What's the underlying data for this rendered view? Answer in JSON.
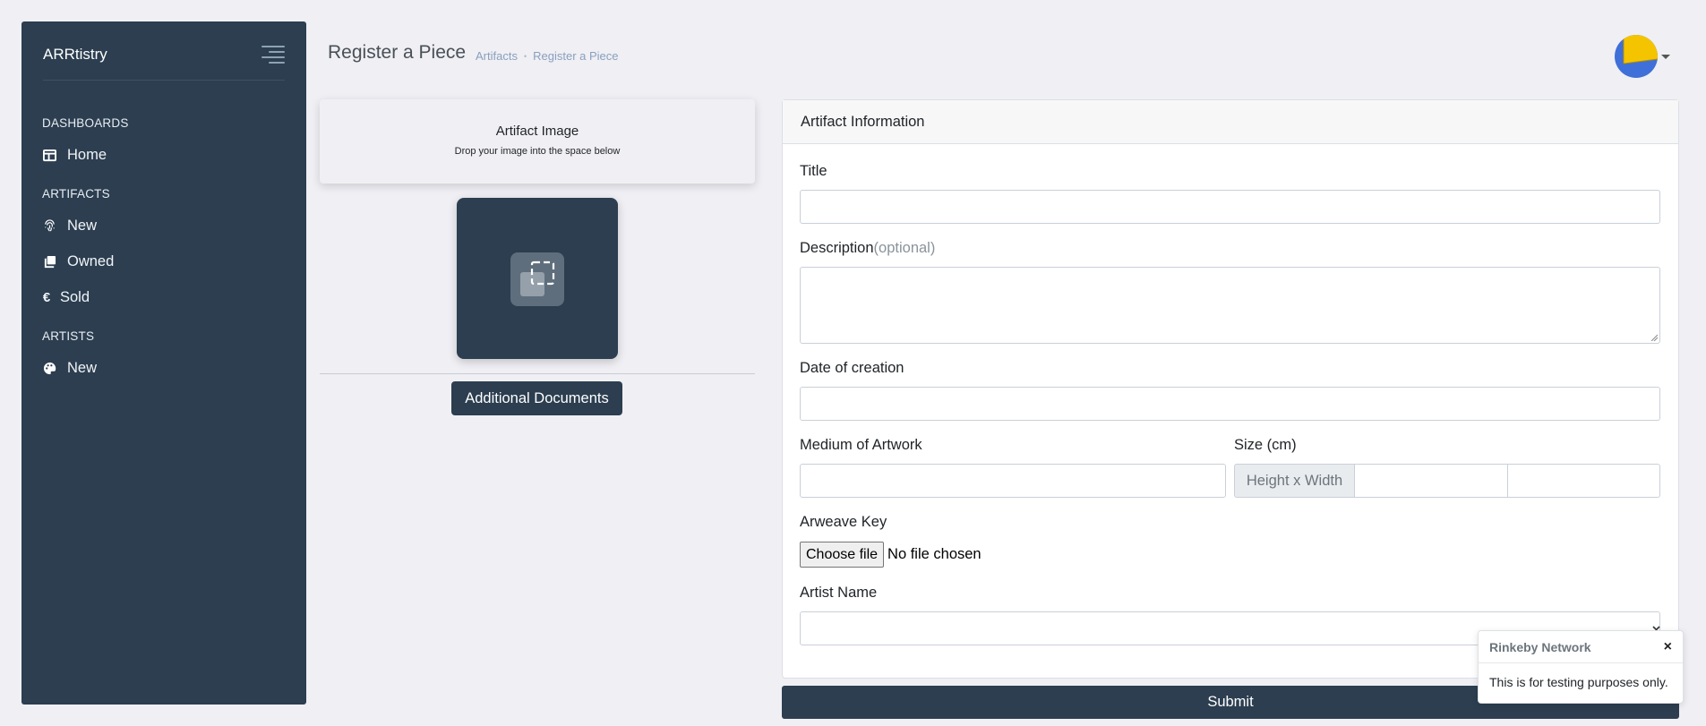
{
  "sidebar": {
    "brand": "ARRtistry",
    "sections": [
      {
        "heading": "DASHBOARDS",
        "items": [
          {
            "label": "Home",
            "icon": "home-layout-icon"
          }
        ]
      },
      {
        "heading": "ARTIFACTS",
        "items": [
          {
            "label": "New",
            "icon": "fingerprint-icon"
          },
          {
            "label": "Owned",
            "icon": "copy-icon"
          },
          {
            "label": "Sold",
            "icon": "euro-icon"
          }
        ]
      },
      {
        "heading": "ARTISTS",
        "items": [
          {
            "label": "New",
            "icon": "palette-icon"
          }
        ]
      }
    ]
  },
  "header": {
    "title": "Register a Piece",
    "breadcrumb": [
      "Artifacts",
      "Register a Piece"
    ],
    "breadcrumb_separator": "•"
  },
  "image_panel": {
    "title": "Artifact Image",
    "subtitle": "Drop your image into the space below",
    "dropzone_icon": "image-upload-icon",
    "docs_button": "Additional Documents"
  },
  "form": {
    "card_title": "Artifact Information",
    "title_label": "Title",
    "title_value": "",
    "description_label": "Description",
    "description_optional": "(optional)",
    "description_value": "",
    "date_label": "Date of creation",
    "date_value": "",
    "medium_label": "Medium of Artwork",
    "medium_value": "",
    "size_label": "Size (cm)",
    "size_addon": "Height x Width",
    "height_value": "",
    "width_value": "",
    "arweave_label": "Arweave Key",
    "file_button": "Choose file",
    "file_status": "No file chosen",
    "artist_label": "Artist Name",
    "artist_value": "",
    "submit": "Submit"
  },
  "toast": {
    "title": "Rinkeby Network",
    "close": "×",
    "body": "This is for testing purposes only."
  },
  "colors": {
    "sidebar_bg": "#2c3e50",
    "page_bg": "#efeff4",
    "accent": "#2c3e50",
    "avatar_yellow": "#f5c400",
    "avatar_blue": "#3f6fd8"
  }
}
